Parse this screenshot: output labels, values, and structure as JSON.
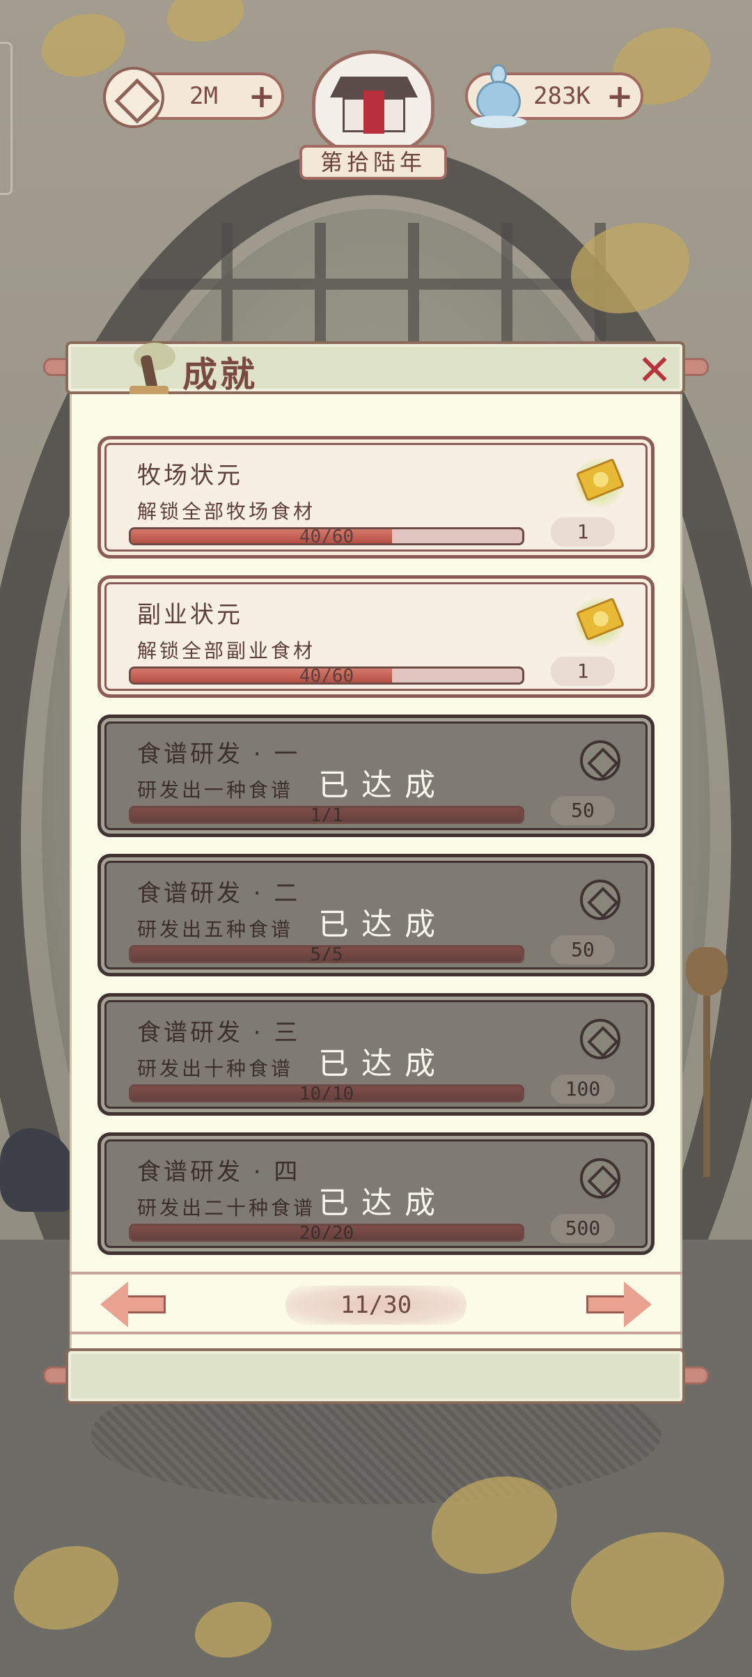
{
  "resources": {
    "coins": "2M",
    "essence": "283K"
  },
  "year": "第拾陆年",
  "panel": {
    "title": "成就"
  },
  "achievements": [
    {
      "title": "牧场状元",
      "desc": "解锁全部牧场食材",
      "progress_text": "40/60",
      "progress": 0.6667,
      "reward": "1",
      "reward_icon": "ticket-icon",
      "completed": false
    },
    {
      "title": "副业状元",
      "desc": "解锁全部副业食材",
      "progress_text": "40/60",
      "progress": 0.6667,
      "reward": "1",
      "reward_icon": "ticket-icon",
      "completed": false
    },
    {
      "title": "食谱研发 · 一",
      "desc": "研发出一种食谱",
      "progress_text": "1/1",
      "progress": 1,
      "reward": "50",
      "reward_icon": "coin-icon",
      "completed": true,
      "status": "已达成"
    },
    {
      "title": "食谱研发 · 二",
      "desc": "研发出五种食谱",
      "progress_text": "5/5",
      "progress": 1,
      "reward": "50",
      "reward_icon": "coin-icon",
      "completed": true,
      "status": "已达成"
    },
    {
      "title": "食谱研发 · 三",
      "desc": "研发出十种食谱",
      "progress_text": "10/10",
      "progress": 1,
      "reward": "100",
      "reward_icon": "coin-icon",
      "completed": true,
      "status": "已达成"
    },
    {
      "title": "食谱研发 · 四",
      "desc": "研发出二十种食谱",
      "progress_text": "20/20",
      "progress": 1,
      "reward": "500",
      "reward_icon": "coin-icon",
      "completed": true,
      "status": "已达成"
    }
  ],
  "pagination": {
    "page": "11/30"
  },
  "colors": {
    "accent": "#a36a61",
    "close": "#b8343c",
    "progress": "#c05a4e",
    "panel": "#fcfbe8"
  }
}
